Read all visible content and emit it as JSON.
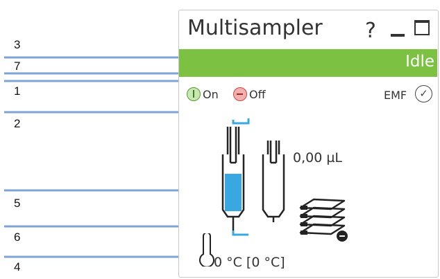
{
  "panel": {
    "title": "Multisampler",
    "help_label": "?",
    "status": "Idle",
    "status_color": "#7cc142",
    "power": {
      "on_label": "On",
      "off_label": "Off"
    },
    "emf_label": "EMF",
    "volume": "0,00 µL",
    "temperature": "0 °C [0 °C]"
  },
  "callouts": [
    "3",
    "7",
    "1",
    "2",
    "5",
    "6",
    "4"
  ],
  "icons": [
    "help-icon",
    "minimize-icon",
    "maximize-icon",
    "power-on-icon",
    "power-off-icon",
    "check-circle-icon",
    "syringe-icon",
    "sample-trays-icon",
    "thermometer-icon"
  ],
  "colors": {
    "accent": "#7cc142",
    "line": "#7ea3d4",
    "liquid": "#3aa8e0"
  }
}
